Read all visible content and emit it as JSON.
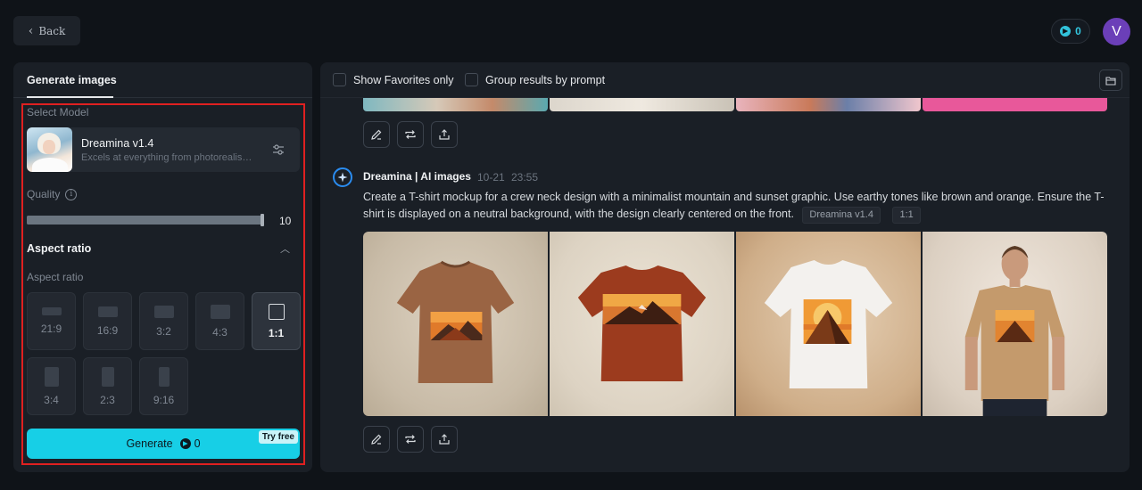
{
  "header": {
    "back_label": "Back",
    "credits": "0",
    "avatar_letter": "V"
  },
  "left_panel": {
    "tab_label": "Generate images",
    "select_model_label": "Select Model",
    "model": {
      "name": "Dreamina v1.4",
      "description": "Excels at everything from photorealism to painterly style"
    },
    "quality_label": "Quality",
    "quality_value": "10",
    "quality_fraction": 1.0,
    "aspect_section_title": "Aspect ratio",
    "aspect_label": "Aspect ratio",
    "aspect_ratios": [
      {
        "label": "21:9",
        "selected": false
      },
      {
        "label": "16:9",
        "selected": false
      },
      {
        "label": "3:2",
        "selected": false
      },
      {
        "label": "4:3",
        "selected": false
      },
      {
        "label": "1:1",
        "selected": true
      },
      {
        "label": "3:4",
        "selected": false
      },
      {
        "label": "2:3",
        "selected": false
      },
      {
        "label": "9:16",
        "selected": false
      }
    ],
    "generate_label": "Generate",
    "generate_cost": "0",
    "try_free_label": "Try free"
  },
  "right_panel": {
    "show_favorites_label": "Show Favorites only",
    "group_results_label": "Group results by prompt",
    "result": {
      "author": "Dreamina | AI images",
      "date": "10-21",
      "time": "23:55",
      "prompt": "Create a T-shirt mockup for a crew neck design with a minimalist mountain and sunset graphic. Use earthy tones like brown and orange. Ensure the T-shirt is displayed on a neutral background, with the design clearly centered on the front.",
      "model_tag": "Dreamina v1.4",
      "ratio_tag": "1:1"
    }
  },
  "colors": {
    "accent": "#17cfe6",
    "background": "#0f1318",
    "panel": "#1a1f26",
    "highlight": "#e02020",
    "avatar": "#6b3fb8"
  }
}
